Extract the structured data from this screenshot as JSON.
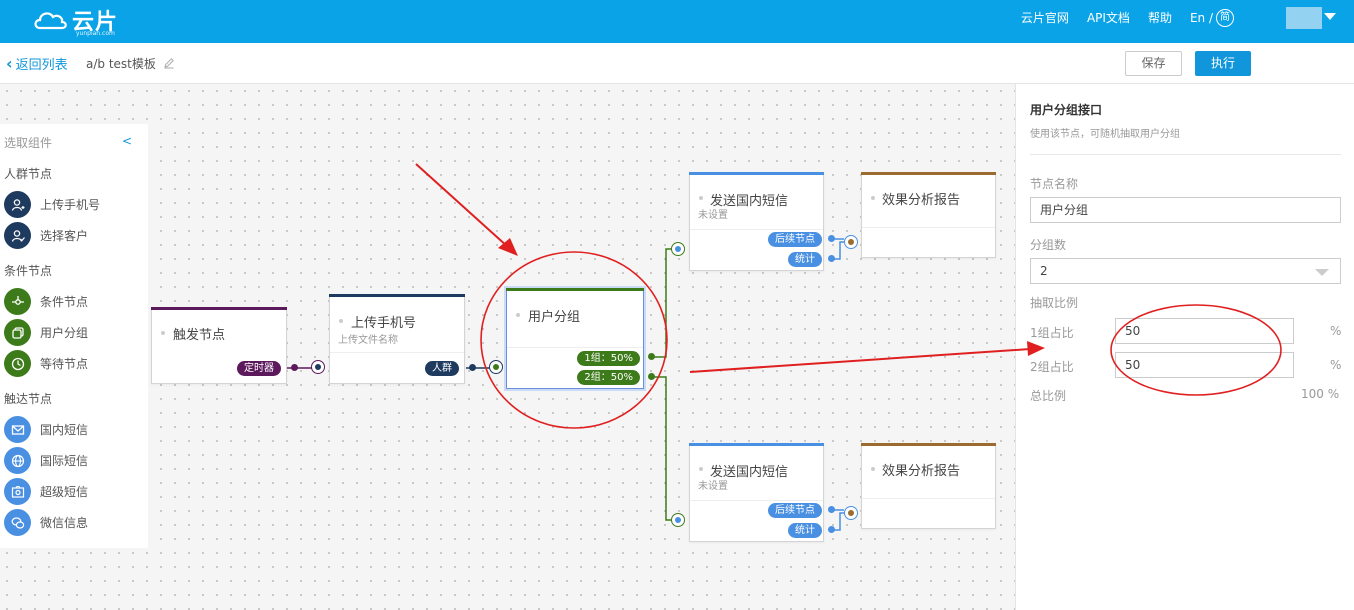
{
  "header": {
    "logo_text": "云片",
    "logo_sub": "yunpian.com",
    "nav": [
      "云片官网",
      "API文档",
      "帮助"
    ],
    "lang_en": "En /",
    "lang_cn": "简"
  },
  "toolbar": {
    "back_label": "返回列表",
    "template_name": "a/b test模板",
    "save_label": "保存",
    "run_label": "执行"
  },
  "palette": {
    "title": "选取组件",
    "collapse": "<",
    "sections": [
      {
        "title": "人群节点",
        "items": [
          {
            "label": "上传手机号",
            "icon": "user-add-icon"
          },
          {
            "label": "选择客户",
            "icon": "user-check-icon"
          }
        ]
      },
      {
        "title": "条件节点",
        "items": [
          {
            "label": "条件节点",
            "icon": "condition-icon"
          },
          {
            "label": "用户分组",
            "icon": "group-icon"
          },
          {
            "label": "等待节点",
            "icon": "clock-icon"
          }
        ]
      },
      {
        "title": "触达节点",
        "items": [
          {
            "label": "国内短信",
            "icon": "mail-icon"
          },
          {
            "label": "国际短信",
            "icon": "globe-icon"
          },
          {
            "label": "超级短信",
            "icon": "image-icon"
          },
          {
            "label": "微信信息",
            "icon": "wechat-icon"
          }
        ]
      }
    ]
  },
  "flow": {
    "trigger": {
      "name": "触发节点",
      "badge": "定时器"
    },
    "upload": {
      "name": "上传手机号",
      "sub": "上传文件名称",
      "badge": "人群"
    },
    "group": {
      "name": "用户分组",
      "out1": "1组：50%",
      "out2": "2组：50%"
    },
    "sms1": {
      "name": "发送国内短信",
      "sub": "未设置",
      "out1": "后续节点",
      "out2": "统计"
    },
    "report1": {
      "name": "效果分析报告"
    },
    "sms2": {
      "name": "发送国内短信",
      "sub": "未设置",
      "out1": "后续节点",
      "out2": "统计"
    },
    "report2": {
      "name": "效果分析报告"
    }
  },
  "panel": {
    "title": "用户分组接口",
    "desc": "使用该节点，可随机抽取用户分组",
    "node_name_label": "节点名称",
    "node_name_value": "用户分组",
    "group_count_label": "分组数",
    "group_count_value": "2",
    "ratio_label": "抽取比例",
    "g1_label": "1组占比",
    "g1_value": "50",
    "g2_label": "2组占比",
    "g2_value": "50",
    "pct": "%",
    "total_label": "总比例",
    "total_value": "100 %"
  },
  "colors": {
    "accent": "#0aa3e8",
    "primary": "#1296db",
    "purple": "#5c1a5c",
    "navy": "#1e3a5f",
    "green": "#3d7b1a",
    "blue": "#4a90e2",
    "brown": "#9b6b2f",
    "annotation": "#e02020"
  }
}
